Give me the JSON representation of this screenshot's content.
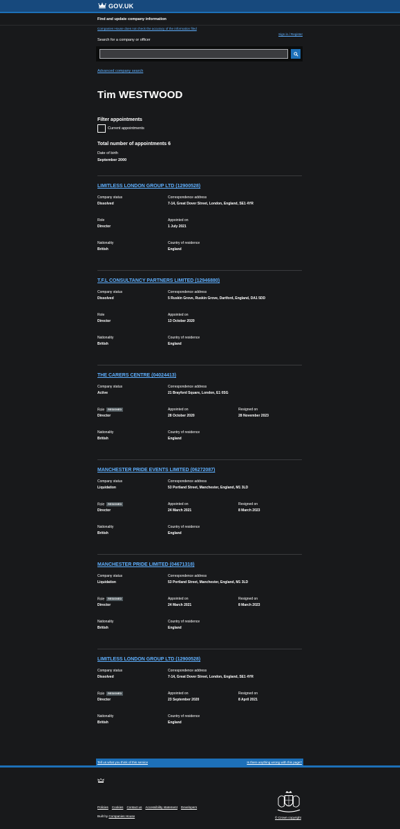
{
  "header": {
    "logo_text": "GOV.UK"
  },
  "service": {
    "name": "Find and update company information"
  },
  "phase_banner": {
    "text": "Companies House does not check the accuracy of the information filed"
  },
  "signin": {
    "label": "Sign in / Register"
  },
  "search": {
    "label": "Search for a company or officer",
    "value": "",
    "placeholder": "",
    "advanced_link": "Advanced company search"
  },
  "officer": {
    "name": "Tim WESTWOOD",
    "filter_title": "Filter appointments",
    "filter_checkbox_label": "Current appointments",
    "total_label": "Total number of appointments 6",
    "dob_label": "Date of birth",
    "dob_value": "September 2000"
  },
  "labels": {
    "company_status": "Company status",
    "correspondence_address": "Correspondence address",
    "role": "Role",
    "appointed_on": "Appointed on",
    "resigned_on": "Resigned on",
    "nationality": "Nationality",
    "country_of_residence": "Country of residence",
    "resigned_tag": "RESIGNED"
  },
  "appointments": [
    {
      "title": "LIMITLESS LONDON GROUP LTD (12900528)",
      "status": "Dissolved",
      "address": "7-14, Great Dover Street, London, England, SE1 4YR",
      "role": "Director",
      "appointed_on": "1 July 2021",
      "resigned_on": "",
      "nationality": "British",
      "country": "England"
    },
    {
      "title": "T.F.L CONSULTANCY PARTNERS LIMITED (12946880)",
      "status": "Dissolved",
      "address": "5 Ruskin Grove, Ruskin Grove, Dartford, England, DA1 5DD",
      "role": "Director",
      "appointed_on": "13 October 2020",
      "resigned_on": "",
      "nationality": "British",
      "country": "England"
    },
    {
      "title": "THE CARERS CENTRE (04024413)",
      "status": "Active",
      "address": "21 Brayford Square, London, E1 0SG",
      "role": "Director",
      "appointed_on": "28 October 2020",
      "resigned_on": "28 November 2023",
      "nationality": "British",
      "country": "England"
    },
    {
      "title": "MANCHESTER PRIDE EVENTS LIMITED (06272087)",
      "status": "Liquidation",
      "address": "53 Portland Street, Manchester, England, M1 3LD",
      "role": "Director",
      "appointed_on": "24 March 2021",
      "resigned_on": "8 March 2023",
      "nationality": "British",
      "country": "England"
    },
    {
      "title": "MANCHESTER PRIDE LIMITED (04671318)",
      "status": "Liquidation",
      "address": "53 Portland Street, Manchester, England, M1 3LD",
      "role": "Director",
      "appointed_on": "24 March 2021",
      "resigned_on": "8 March 2023",
      "nationality": "British",
      "country": "England"
    },
    {
      "title": "LIMITLESS LONDON GROUP LTD (12900528)",
      "status": "Dissolved",
      "address": "7-14, Great Dover Street, London, England, SE1 4YR",
      "role": "Director",
      "appointed_on": "23 September 2020",
      "resigned_on": "8 April 2021",
      "nationality": "British",
      "country": "England"
    }
  ],
  "feedback": {
    "left": "Tell us what you think of this service",
    "right": "Is there anything wrong with this page?"
  },
  "footer": {
    "links": [
      "Policies",
      "Cookies",
      "Contact us",
      "Accessibility statement",
      "Developers"
    ],
    "built_by_prefix": "Built by ",
    "built_by_link": "Companies House",
    "copyright": "© Crown copyright"
  },
  "colors": {
    "background": "#18191b",
    "header_blue": "#17497d",
    "accent_blue": "#1d70b8",
    "link": "#5fb0ff"
  }
}
